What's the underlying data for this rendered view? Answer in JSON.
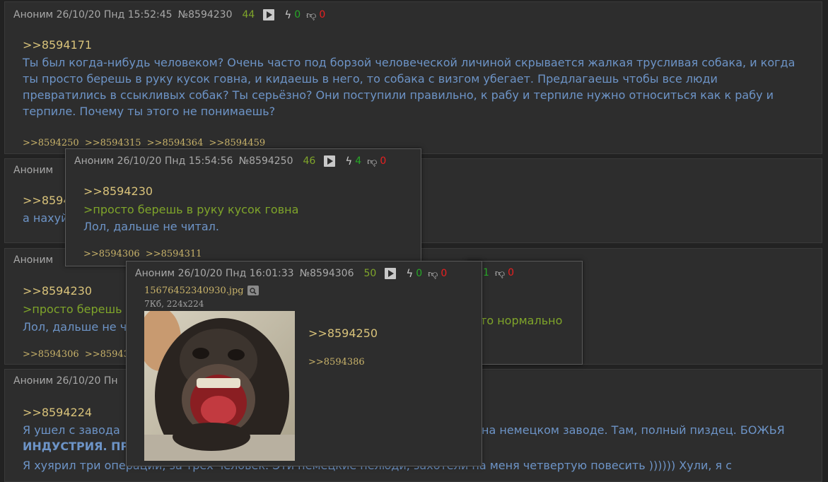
{
  "posts": [
    {
      "author": "Аноним",
      "date": "26/10/20 Пнд 15:52:45",
      "num": "№8594230",
      "count": "44",
      "likes": "0",
      "dislikes": "0",
      "reply": ">>8594171",
      "text": "Ты был когда-нибудь человеком? Очень часто под борзой человеческой личиной скрывается жалкая трусливая собака, и когда ты просто берешь в руку кусок говна, и кидаешь в него, то собака с визгом убегает. Предлагаешь чтобы все люди превратились в ссыкливых собак? Ты серьёзно? Они поступили правильно, к рабу и терпиле нужно относиться как к рабу и терпиле. Почему ты этого не понимаешь?",
      "refs": [
        ">>8594250",
        ">>8594315",
        ">>8594364",
        ">>8594459"
      ]
    },
    {
      "author": "Аноним",
      "reply": ">>8594",
      "text": "а нахуй"
    },
    {
      "author": "Аноним",
      "reply": ">>8594230",
      "quote": ">просто берешь",
      "text": "Лол, дальше не ч",
      "refs": [
        ">>8594306",
        ">>8594311"
      ],
      "tail": "то нормально"
    },
    {
      "author": "Аноним",
      "date": "26/10/20 Пн",
      "reply": ">>8594224",
      "line1a": "Я ушел с завода",
      "line1b": "на немецком заводе. Там, полный пиздец. БОЖЬЯ",
      "line2": "ИНДУСТРИЯ. ПР",
      "line3": "Я хуярил три операции, за трёх человек. Эти немецкие нелюди, захотели на меня четвертую повесить )))))) Хули, я с"
    }
  ],
  "popups": [
    {
      "author": "Аноним",
      "date": "26/10/20 Пнд 15:54:56",
      "num": "№8594250",
      "count": "46",
      "likes": "4",
      "dislikes": "0",
      "reply": ">>8594230",
      "quote": ">просто берешь в руку кусок говна",
      "text": "Лол, дальше не читал.",
      "refs": [
        ">>8594306",
        ">>8594311"
      ]
    },
    {
      "author": "Аноним",
      "date": "26/10/20 Пнд 16:01:33",
      "num": "№8594306",
      "count": "50",
      "likes": "0",
      "dislikes": "0",
      "likes_b": "1",
      "dislikes_b": "0",
      "file_name": "15676452340930.jpg",
      "file_meta": "7Кб, 224x224",
      "image_icon": "laughing-chimpanzee",
      "reply": ">>8594250",
      "refs": [
        ">>8594386"
      ]
    }
  ],
  "colors": {
    "background": "#222222",
    "post_bg": "#2d2d2d",
    "text_blue": "#6d94c7",
    "quote_green": "#7fa52a",
    "reply_gold": "#d8c27a",
    "like_green": "#27a827",
    "dislike_red": "#e82020"
  }
}
